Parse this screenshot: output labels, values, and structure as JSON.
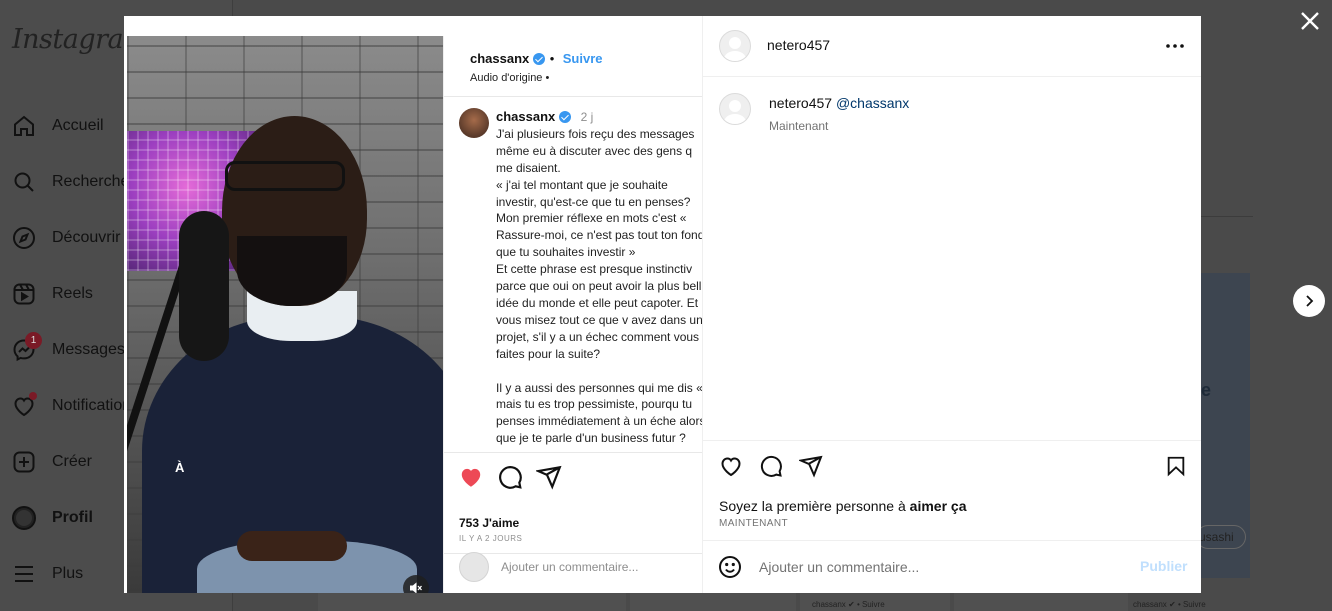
{
  "background": {
    "logo": "Instagram",
    "nav": [
      {
        "label": "Accueil",
        "icon": "home-icon"
      },
      {
        "label": "Recherche",
        "icon": "search-icon"
      },
      {
        "label": "Découvrir",
        "icon": "compass-icon"
      },
      {
        "label": "Reels",
        "icon": "reels-icon"
      },
      {
        "label": "Messages",
        "icon": "messenger-icon",
        "badge": "1"
      },
      {
        "label": "Notifications",
        "icon": "heart-icon"
      },
      {
        "label": "Créer",
        "icon": "plus-square-icon"
      },
      {
        "label": "Profil",
        "icon": "profile-avatar-icon"
      },
      {
        "label": "Plus",
        "icon": "menu-icon"
      }
    ],
    "card_text": "e",
    "pill_text": "usashi",
    "strip_text_1": "chassanx ✔ • Suivre",
    "strip_text_2": "chassanx ✔ • Suivre"
  },
  "overlay": {
    "close_icon": "close-icon",
    "next_icon": "chevron-right-icon"
  },
  "media": {
    "photo_caption": "À",
    "inner": {
      "user": "chassanx",
      "follow": "Suivre",
      "audio": "Audio d'origine •",
      "comment_user": "chassanx",
      "comment_time": "2 j",
      "comment_text": "J'ai plusieurs fois reçu des messages même eu à discuter avec des gens q me disaient.\n« j'ai tel montant que je souhaite investir, qu'est-ce que tu en penses? Mon premier réflexe en mots c'est « Rassure-moi, ce n'est pas tout ton fond que tu souhaites investir »\nEt cette phrase est presque instinctiv parce que oui on peut avoir la plus belle idée du monde et elle peut capoter. Et vous misez tout ce que v avez dans un projet, s'il y a un échec comment vous faites pour la suite?\n\nIl y a aussi des personnes qui me dis « mais tu es trop pessimiste, pourqu tu penses immédiatement à un éche alors que je te parle d'un business futur ?",
      "likes": "753 J'aime",
      "time": "IL Y A 2 JOURS",
      "add_comment": "Ajouter un commentaire..."
    }
  },
  "panel": {
    "header_user": "netero457",
    "comment": {
      "user": "netero457",
      "mention": "@chassanx",
      "time": "Maintenant"
    },
    "likes_prefix": "Soyez la première personne à ",
    "likes_bold": "aimer ça",
    "date": "MAINTENANT",
    "comment_placeholder": "Ajouter un commentaire...",
    "publish_label": "Publier"
  },
  "colors": {
    "like_red": "#ed4956",
    "link_blue": "#3897f0",
    "publish_disabled": "#c0dffd"
  }
}
